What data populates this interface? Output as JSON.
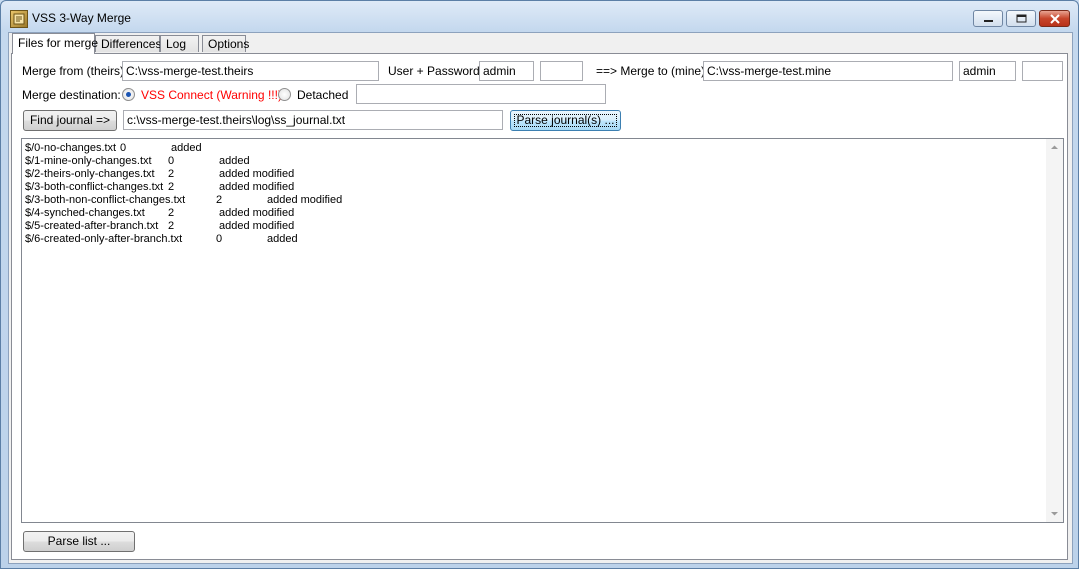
{
  "window": {
    "title": "VSS 3-Way Merge"
  },
  "tabs": [
    {
      "label": "Files for merge"
    },
    {
      "label": "Differences"
    },
    {
      "label": "Log"
    },
    {
      "label": "Options"
    }
  ],
  "form": {
    "merge_from_label": "Merge from (theirs):",
    "merge_from_value": "C:\\vss-merge-test.theirs",
    "user_password_label": "User + Password",
    "user_theirs": "admin",
    "password_theirs": "",
    "merge_to_label": "==> Merge to (mine):",
    "merge_to_value": "C:\\vss-merge-test.mine",
    "user_mine": "admin",
    "password_mine": "",
    "merge_destination_label": "Merge destination:",
    "vss_connect_label": "VSS Connect (Warning !!!)",
    "detached_label": "Detached",
    "detached_value": "",
    "find_journal_label": "Find journal =>",
    "journal_path": "c:\\vss-merge-test.theirs\\log\\ss_journal.txt",
    "parse_journals_label": "Parse journal(s) ..."
  },
  "colors": {
    "warning": "#ff0000"
  },
  "journal_entries": [
    {
      "file": "$/0-no-changes.txt",
      "count": "0",
      "changes": "added"
    },
    {
      "file": "$/1-mine-only-changes.txt",
      "count": "0",
      "changes": "added"
    },
    {
      "file": "$/2-theirs-only-changes.txt",
      "count": "2",
      "changes": "added modified"
    },
    {
      "file": "$/3-both-conflict-changes.txt",
      "count": "2",
      "changes": "added modified"
    },
    {
      "file": "$/3-both-non-conflict-changes.txt",
      "count": "2",
      "changes": "added modified"
    },
    {
      "file": "$/4-synched-changes.txt",
      "count": "2",
      "changes": "added modified"
    },
    {
      "file": "$/5-created-after-branch.txt",
      "count": "2",
      "changes": "added modified"
    },
    {
      "file": "$/6-created-only-after-branch.txt",
      "count": "0",
      "changes": "added"
    }
  ],
  "footer": {
    "parse_list_label": "Parse list ..."
  }
}
